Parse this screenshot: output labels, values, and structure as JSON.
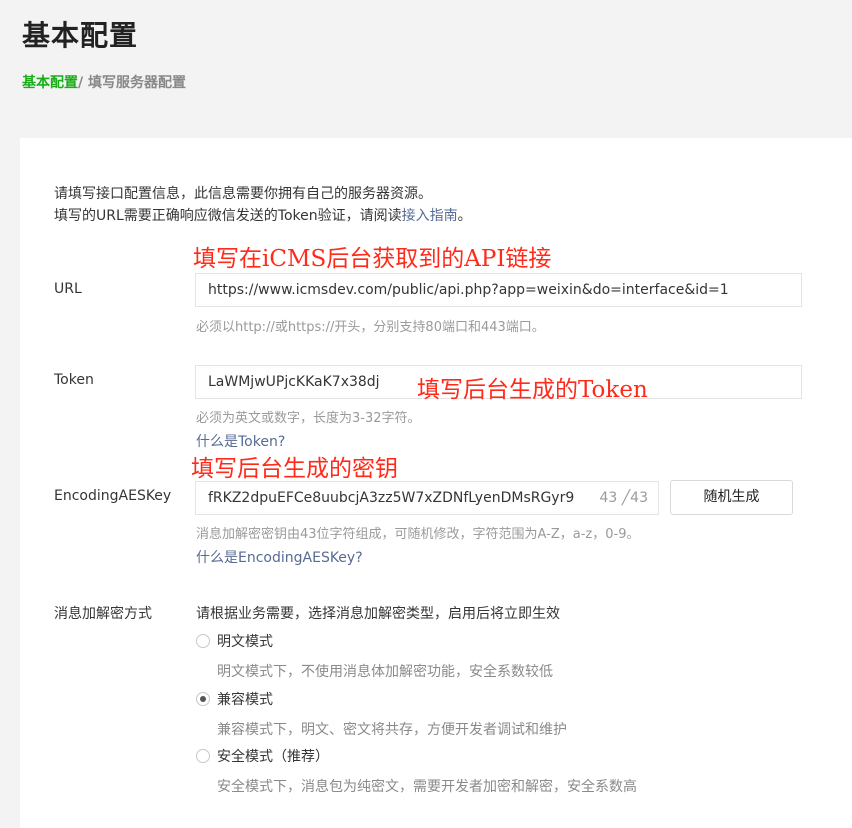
{
  "header": {
    "title": "基本配置",
    "breadcrumb_home": "基本配置",
    "breadcrumb_sep": "/",
    "breadcrumb_current": "填写服务器配置"
  },
  "intro": {
    "line1": "请填写接口配置信息，此信息需要你拥有自己的服务器资源。",
    "line2_prefix": "填写的URL需要正确响应微信发送的Token验证，请阅读",
    "line2_link": "接入指南",
    "line2_suffix": "。"
  },
  "annotations": {
    "url": "填写在iCMS后台获取到的API链接",
    "token": "填写后台生成的Token",
    "aes": "填写后台生成的密钥"
  },
  "url": {
    "label": "URL",
    "value": "https://www.icmsdev.com/public/api.php?app=weixin&do=interface&id=1",
    "hint": "必须以http://或https://开头，分别支持80端口和443端口。"
  },
  "token": {
    "label": "Token",
    "value": "LaWMjwUPjcKKaK7x38dj",
    "hint": "必须为英文或数字，长度为3-32字符。",
    "help_link": "什么是Token?"
  },
  "aes": {
    "label": "EncodingAESKey",
    "value": "fRKZ2dpuEFCe8uubcjA3zz5W7xZDNfLyenDMsRGyr9",
    "counter": "43 ╱43",
    "generate_button": "随机生成",
    "hint": "消息加解密密钥由43位字符组成，可随机修改，字符范围为A-Z，a-z，0-9。",
    "help_link": "什么是EncodingAESKey?"
  },
  "encryption": {
    "label": "消息加解密方式",
    "description": "请根据业务需要，选择消息加解密类型，启用后将立即生效",
    "options": [
      {
        "label": "明文模式",
        "desc": "明文模式下，不使用消息体加解密功能，安全系数较低",
        "selected": false
      },
      {
        "label": "兼容模式",
        "desc": "兼容模式下，明文、密文将共存，方便开发者调试和维护",
        "selected": true
      },
      {
        "label": "安全模式（推荐）",
        "desc": "安全模式下，消息包为纯密文，需要开发者加密和解密，安全系数高",
        "selected": false
      }
    ]
  },
  "colors": {
    "accent_green": "#1aad19",
    "link_blue": "#576b95",
    "annotation_red": "#ff2a1a"
  }
}
